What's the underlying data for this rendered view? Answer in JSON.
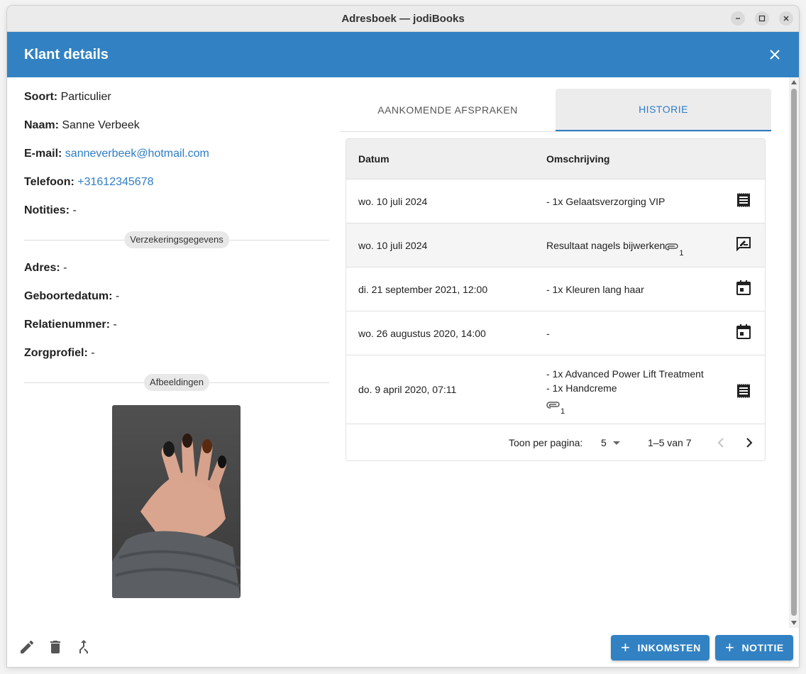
{
  "window": {
    "title": "Adresboek — jodiBooks"
  },
  "header": {
    "title": "Klant details"
  },
  "details": {
    "soort": {
      "label": "Soort:",
      "value": "Particulier"
    },
    "naam": {
      "label": "Naam:",
      "value": "Sanne Verbeek"
    },
    "email": {
      "label": "E-mail:",
      "value": "sanneverbeek@hotmail.com"
    },
    "telefoon": {
      "label": "Telefoon:",
      "value": "+31612345678"
    },
    "notities": {
      "label": "Notities:",
      "value": "-"
    }
  },
  "insurance": {
    "chip": "Verzekeringsgegevens",
    "adres": {
      "label": "Adres:",
      "value": "-"
    },
    "geboortedatum": {
      "label": "Geboortedatum:",
      "value": "-"
    },
    "relatienummer": {
      "label": "Relatienummer:",
      "value": "-"
    },
    "zorgprofiel": {
      "label": "Zorgprofiel:",
      "value": "-"
    }
  },
  "images": {
    "chip": "Afbeeldingen"
  },
  "tabs": [
    {
      "label": "AANKOMENDE AFSPRAKEN",
      "active": false
    },
    {
      "label": "HISTORIE",
      "active": true
    }
  ],
  "table": {
    "headers": {
      "datum": "Datum",
      "omschrijving": "Omschrijving"
    },
    "rows": [
      {
        "datum": "wo. 10 juli 2024",
        "lines": [
          "- 1x Gelaatsverzorging VIP"
        ],
        "attachments": "",
        "icon": "receipt-icon"
      },
      {
        "datum": "wo. 10 juli 2024",
        "lines": [
          "Resultaat nagels bijwerken"
        ],
        "attachments": "1",
        "icon": "note-edit-icon"
      },
      {
        "datum": "di. 21 september 2021, 12:00",
        "lines": [
          "- 1x Kleuren lang haar"
        ],
        "attachments": "",
        "icon": "calendar-icon"
      },
      {
        "datum": "wo. 26 augustus 2020, 14:00",
        "lines": [
          "-"
        ],
        "attachments": "",
        "icon": "calendar-icon"
      },
      {
        "datum": "do. 9 april 2020, 07:11",
        "lines": [
          "- 1x Advanced Power Lift Treatment",
          "- 1x Handcreme"
        ],
        "attachments": "1",
        "icon": "receipt-icon"
      }
    ],
    "pagination": {
      "label": "Toon per pagina:",
      "per_page": "5",
      "range": "1–5 van 7"
    }
  },
  "buttons": {
    "inkomsten": "INKOMSTEN",
    "notitie": "NOTITIE"
  },
  "colors": {
    "primary": "#3282c3",
    "link": "#2e7dc4"
  }
}
